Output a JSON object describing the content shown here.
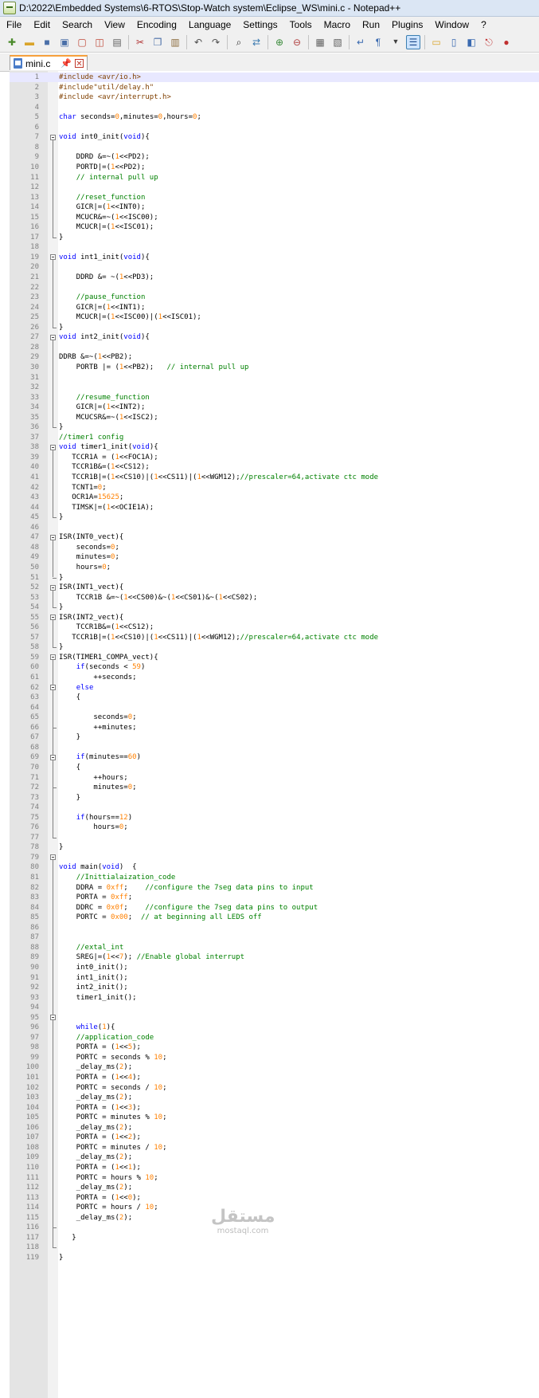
{
  "window": {
    "title": "D:\\2022\\Embedded Systems\\6-RTOS\\Stop-Watch system\\Eclipse_WS\\mini.c - Notepad++"
  },
  "menu": [
    "File",
    "Edit",
    "Search",
    "View",
    "Encoding",
    "Language",
    "Settings",
    "Tools",
    "Macro",
    "Run",
    "Plugins",
    "Window",
    "?"
  ],
  "tab": {
    "label": "mini.c"
  },
  "watermark": {
    "arabic": "مستقل",
    "latin": "mostaql.com"
  },
  "editor": {
    "current_line": 1,
    "folds": [
      {
        "start": 7,
        "end": 17
      },
      {
        "start": 19,
        "end": 26
      },
      {
        "start": 27,
        "end": 36
      },
      {
        "start": 38,
        "end": 45
      },
      {
        "start": 47,
        "end": 51
      },
      {
        "start": 52,
        "end": 54
      },
      {
        "start": 55,
        "end": 58
      },
      {
        "start": 59,
        "end": 77
      },
      {
        "start": 62,
        "end": 66
      },
      {
        "start": 69,
        "end": 72
      },
      {
        "start": 79,
        "end": 118
      },
      {
        "start": 95,
        "end": 116
      }
    ],
    "lines": [
      [
        [
          "p",
          "#include <avr/io.h>"
        ]
      ],
      [
        [
          "p",
          "#include\"util/delay.h\""
        ]
      ],
      [
        [
          "p",
          "#include <avr/interrupt.h>"
        ]
      ],
      [],
      [
        [
          "k",
          "char"
        ],
        [
          "t",
          " seconds="
        ],
        [
          "n",
          "0"
        ],
        [
          "t",
          ",minutes="
        ],
        [
          "n",
          "0"
        ],
        [
          "t",
          ",hours="
        ],
        [
          "n",
          "0"
        ],
        [
          "t",
          ";"
        ]
      ],
      [],
      [
        [
          "k",
          "void"
        ],
        [
          "t",
          " int0_init("
        ],
        [
          "k",
          "void"
        ],
        [
          "t",
          "){"
        ]
      ],
      [],
      [
        [
          "t",
          "    DDRD &=~("
        ],
        [
          "n",
          "1"
        ],
        [
          "t",
          "<<PD2);"
        ]
      ],
      [
        [
          "t",
          "    PORTD|=("
        ],
        [
          "n",
          "1"
        ],
        [
          "t",
          "<<PD2);"
        ]
      ],
      [
        [
          "t",
          "    "
        ],
        [
          "c",
          "// internal pull up"
        ]
      ],
      [],
      [
        [
          "t",
          "    "
        ],
        [
          "c",
          "//reset_function"
        ]
      ],
      [
        [
          "t",
          "    GICR|=("
        ],
        [
          "n",
          "1"
        ],
        [
          "t",
          "<<INT0);"
        ]
      ],
      [
        [
          "t",
          "    MCUCR&=~("
        ],
        [
          "n",
          "1"
        ],
        [
          "t",
          "<<ISC00);"
        ]
      ],
      [
        [
          "t",
          "    MCUCR|=("
        ],
        [
          "n",
          "1"
        ],
        [
          "t",
          "<<ISC01);"
        ]
      ],
      [
        [
          "t",
          "}"
        ]
      ],
      [],
      [
        [
          "k",
          "void"
        ],
        [
          "t",
          " int1_init("
        ],
        [
          "k",
          "void"
        ],
        [
          "t",
          "){"
        ]
      ],
      [],
      [
        [
          "t",
          "    DDRD &= ~("
        ],
        [
          "n",
          "1"
        ],
        [
          "t",
          "<<PD3);"
        ]
      ],
      [],
      [
        [
          "t",
          "    "
        ],
        [
          "c",
          "//pause_function"
        ]
      ],
      [
        [
          "t",
          "    GICR|=("
        ],
        [
          "n",
          "1"
        ],
        [
          "t",
          "<<INT1);"
        ]
      ],
      [
        [
          "t",
          "    MCUCR|=("
        ],
        [
          "n",
          "1"
        ],
        [
          "t",
          "<<ISC00)|("
        ],
        [
          "n",
          "1"
        ],
        [
          "t",
          "<<ISC01);"
        ]
      ],
      [
        [
          "t",
          "}"
        ]
      ],
      [
        [
          "k",
          "void"
        ],
        [
          "t",
          " int2_init("
        ],
        [
          "k",
          "void"
        ],
        [
          "t",
          "){"
        ]
      ],
      [],
      [
        [
          "t",
          "DDRB &=~("
        ],
        [
          "n",
          "1"
        ],
        [
          "t",
          "<<PB2);"
        ]
      ],
      [
        [
          "t",
          "    PORTB |= ("
        ],
        [
          "n",
          "1"
        ],
        [
          "t",
          "<<PB2);   "
        ],
        [
          "c",
          "// internal pull up"
        ]
      ],
      [],
      [],
      [
        [
          "t",
          "    "
        ],
        [
          "c",
          "//resume_function"
        ]
      ],
      [
        [
          "t",
          "    GICR|=("
        ],
        [
          "n",
          "1"
        ],
        [
          "t",
          "<<INT2);"
        ]
      ],
      [
        [
          "t",
          "    MCUCSR&=~("
        ],
        [
          "n",
          "1"
        ],
        [
          "t",
          "<<ISC2);"
        ]
      ],
      [
        [
          "t",
          "}"
        ]
      ],
      [
        [
          "c",
          "//timer1 config"
        ]
      ],
      [
        [
          "k",
          "void"
        ],
        [
          "t",
          " timer1_init("
        ],
        [
          "k",
          "void"
        ],
        [
          "t",
          "){"
        ]
      ],
      [
        [
          "t",
          "   TCCR1A = ("
        ],
        [
          "n",
          "1"
        ],
        [
          "t",
          "<<FOC1A);"
        ]
      ],
      [
        [
          "t",
          "   TCCR1B&=("
        ],
        [
          "n",
          "1"
        ],
        [
          "t",
          "<<CS12);"
        ]
      ],
      [
        [
          "t",
          "   TCCR1B|=("
        ],
        [
          "n",
          "1"
        ],
        [
          "t",
          "<<CS10)|("
        ],
        [
          "n",
          "1"
        ],
        [
          "t",
          "<<CS11)|("
        ],
        [
          "n",
          "1"
        ],
        [
          "t",
          "<<WGM12);"
        ],
        [
          "c",
          "//prescaler=64,activate ctc mode"
        ]
      ],
      [
        [
          "t",
          "   TCNT1="
        ],
        [
          "n",
          "0"
        ],
        [
          "t",
          ";"
        ]
      ],
      [
        [
          "t",
          "   OCR1A="
        ],
        [
          "n",
          "15625"
        ],
        [
          "t",
          ";"
        ]
      ],
      [
        [
          "t",
          "   TIMSK|=("
        ],
        [
          "n",
          "1"
        ],
        [
          "t",
          "<<OCIE1A);"
        ]
      ],
      [
        [
          "t",
          "}"
        ]
      ],
      [],
      [
        [
          "t",
          "ISR(INT0_vect){"
        ]
      ],
      [
        [
          "t",
          "    seconds="
        ],
        [
          "n",
          "0"
        ],
        [
          "t",
          ";"
        ]
      ],
      [
        [
          "t",
          "    minutes="
        ],
        [
          "n",
          "0"
        ],
        [
          "t",
          ";"
        ]
      ],
      [
        [
          "t",
          "    hours="
        ],
        [
          "n",
          "0"
        ],
        [
          "t",
          ";"
        ]
      ],
      [
        [
          "t",
          "}"
        ]
      ],
      [
        [
          "t",
          "ISR(INT1_vect){"
        ]
      ],
      [
        [
          "t",
          "    TCCR1B &=~("
        ],
        [
          "n",
          "1"
        ],
        [
          "t",
          "<<CS00)&~("
        ],
        [
          "n",
          "1"
        ],
        [
          "t",
          "<<CS01)&~("
        ],
        [
          "n",
          "1"
        ],
        [
          "t",
          "<<CS02);"
        ]
      ],
      [
        [
          "t",
          "}"
        ]
      ],
      [
        [
          "t",
          "ISR(INT2_vect){"
        ]
      ],
      [
        [
          "t",
          "    TCCR1B&=("
        ],
        [
          "n",
          "1"
        ],
        [
          "t",
          "<<CS12);"
        ]
      ],
      [
        [
          "t",
          "   TCCR1B|=("
        ],
        [
          "n",
          "1"
        ],
        [
          "t",
          "<<CS10)|("
        ],
        [
          "n",
          "1"
        ],
        [
          "t",
          "<<CS11)|("
        ],
        [
          "n",
          "1"
        ],
        [
          "t",
          "<<WGM12);"
        ],
        [
          "c",
          "//prescaler=64,activate ctc mode"
        ]
      ],
      [
        [
          "t",
          "}"
        ]
      ],
      [
        [
          "t",
          "ISR(TIMER1_COMPA_vect){"
        ]
      ],
      [
        [
          "t",
          "    "
        ],
        [
          "k",
          "if"
        ],
        [
          "t",
          "(seconds < "
        ],
        [
          "n",
          "59"
        ],
        [
          "t",
          ")"
        ]
      ],
      [
        [
          "t",
          "        ++seconds;"
        ]
      ],
      [
        [
          "t",
          "    "
        ],
        [
          "k",
          "else"
        ]
      ],
      [
        [
          "t",
          "    {"
        ]
      ],
      [],
      [
        [
          "t",
          "        seconds="
        ],
        [
          "n",
          "0"
        ],
        [
          "t",
          ";"
        ]
      ],
      [
        [
          "t",
          "        ++minutes;"
        ]
      ],
      [
        [
          "t",
          "    }"
        ]
      ],
      [],
      [
        [
          "t",
          "    "
        ],
        [
          "k",
          "if"
        ],
        [
          "t",
          "(minutes=="
        ],
        [
          "n",
          "60"
        ],
        [
          "t",
          ")"
        ]
      ],
      [
        [
          "t",
          "    {"
        ]
      ],
      [
        [
          "t",
          "        ++hours;"
        ]
      ],
      [
        [
          "t",
          "        minutes="
        ],
        [
          "n",
          "0"
        ],
        [
          "t",
          ";"
        ]
      ],
      [
        [
          "t",
          "    }"
        ]
      ],
      [],
      [
        [
          "t",
          "    "
        ],
        [
          "k",
          "if"
        ],
        [
          "t",
          "(hours=="
        ],
        [
          "n",
          "12"
        ],
        [
          "t",
          ")"
        ]
      ],
      [
        [
          "t",
          "        hours="
        ],
        [
          "n",
          "0"
        ],
        [
          "t",
          ";"
        ]
      ],
      [],
      [
        [
          "t",
          "}"
        ]
      ],
      [],
      [
        [
          "k",
          "void"
        ],
        [
          "t",
          " main("
        ],
        [
          "k",
          "void"
        ],
        [
          "t",
          ")  {"
        ]
      ],
      [
        [
          "t",
          "    "
        ],
        [
          "c",
          "//Inittialaization_code"
        ]
      ],
      [
        [
          "t",
          "    DDRA = "
        ],
        [
          "n",
          "0xff"
        ],
        [
          "t",
          ";    "
        ],
        [
          "c",
          "//configure the 7seg data pins to input"
        ]
      ],
      [
        [
          "t",
          "    PORTA = "
        ],
        [
          "n",
          "0xff"
        ],
        [
          "t",
          ";"
        ]
      ],
      [
        [
          "t",
          "    DDRC = "
        ],
        [
          "n",
          "0x0f"
        ],
        [
          "t",
          ";    "
        ],
        [
          "c",
          "//configure the 7seg data pins to output"
        ]
      ],
      [
        [
          "t",
          "    PORTC = "
        ],
        [
          "n",
          "0x00"
        ],
        [
          "t",
          ";  "
        ],
        [
          "c",
          "// at beginning all LEDS off"
        ]
      ],
      [],
      [],
      [
        [
          "t",
          "    "
        ],
        [
          "c",
          "//extal_int"
        ]
      ],
      [
        [
          "t",
          "    SREG|=("
        ],
        [
          "n",
          "1"
        ],
        [
          "t",
          "<<"
        ],
        [
          "n",
          "7"
        ],
        [
          "t",
          "); "
        ],
        [
          "c",
          "//Enable global interrupt"
        ]
      ],
      [
        [
          "t",
          "    int0_init();"
        ]
      ],
      [
        [
          "t",
          "    int1_init();"
        ]
      ],
      [
        [
          "t",
          "    int2_init();"
        ]
      ],
      [
        [
          "t",
          "    timer1_init();"
        ]
      ],
      [],
      [],
      [
        [
          "t",
          "    "
        ],
        [
          "k",
          "while"
        ],
        [
          "t",
          "("
        ],
        [
          "n",
          "1"
        ],
        [
          "t",
          "){"
        ]
      ],
      [
        [
          "t",
          "    "
        ],
        [
          "c",
          "//application_code"
        ]
      ],
      [
        [
          "t",
          "    PORTA = ("
        ],
        [
          "n",
          "1"
        ],
        [
          "t",
          "<<"
        ],
        [
          "n",
          "5"
        ],
        [
          "t",
          ");"
        ]
      ],
      [
        [
          "t",
          "    PORTC = seconds % "
        ],
        [
          "n",
          "10"
        ],
        [
          "t",
          ";"
        ]
      ],
      [
        [
          "t",
          "    _delay_ms("
        ],
        [
          "n",
          "2"
        ],
        [
          "t",
          ");"
        ]
      ],
      [
        [
          "t",
          "    PORTA = ("
        ],
        [
          "n",
          "1"
        ],
        [
          "t",
          "<<"
        ],
        [
          "n",
          "4"
        ],
        [
          "t",
          ");"
        ]
      ],
      [
        [
          "t",
          "    PORTC = seconds / "
        ],
        [
          "n",
          "10"
        ],
        [
          "t",
          ";"
        ]
      ],
      [
        [
          "t",
          "    _delay_ms("
        ],
        [
          "n",
          "2"
        ],
        [
          "t",
          ");"
        ]
      ],
      [
        [
          "t",
          "    PORTA = ("
        ],
        [
          "n",
          "1"
        ],
        [
          "t",
          "<<"
        ],
        [
          "n",
          "3"
        ],
        [
          "t",
          ");"
        ]
      ],
      [
        [
          "t",
          "    PORTC = minutes % "
        ],
        [
          "n",
          "10"
        ],
        [
          "t",
          ";"
        ]
      ],
      [
        [
          "t",
          "    _delay_ms("
        ],
        [
          "n",
          "2"
        ],
        [
          "t",
          ");"
        ]
      ],
      [
        [
          "t",
          "    PORTA = ("
        ],
        [
          "n",
          "1"
        ],
        [
          "t",
          "<<"
        ],
        [
          "n",
          "2"
        ],
        [
          "t",
          ");"
        ]
      ],
      [
        [
          "t",
          "    PORTC = minutes / "
        ],
        [
          "n",
          "10"
        ],
        [
          "t",
          ";"
        ]
      ],
      [
        [
          "t",
          "    _delay_ms("
        ],
        [
          "n",
          "2"
        ],
        [
          "t",
          ");"
        ]
      ],
      [
        [
          "t",
          "    PORTA = ("
        ],
        [
          "n",
          "1"
        ],
        [
          "t",
          "<<"
        ],
        [
          "n",
          "1"
        ],
        [
          "t",
          ");"
        ]
      ],
      [
        [
          "t",
          "    PORTC = hours % "
        ],
        [
          "n",
          "10"
        ],
        [
          "t",
          ";"
        ]
      ],
      [
        [
          "t",
          "    _delay_ms("
        ],
        [
          "n",
          "2"
        ],
        [
          "t",
          ");"
        ]
      ],
      [
        [
          "t",
          "    PORTA = ("
        ],
        [
          "n",
          "1"
        ],
        [
          "t",
          "<<"
        ],
        [
          "n",
          "0"
        ],
        [
          "t",
          ");"
        ]
      ],
      [
        [
          "t",
          "    PORTC = hours / "
        ],
        [
          "n",
          "10"
        ],
        [
          "t",
          ";"
        ]
      ],
      [
        [
          "t",
          "    _delay_ms("
        ],
        [
          "n",
          "2"
        ],
        [
          "t",
          ");"
        ]
      ],
      [],
      [
        [
          "t",
          "   }"
        ]
      ],
      [],
      [
        [
          "t",
          "}"
        ]
      ]
    ]
  }
}
